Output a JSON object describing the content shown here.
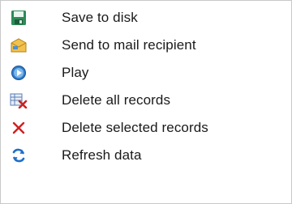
{
  "menu": {
    "items": [
      {
        "label": "Save to disk",
        "icon": "floppy-disk-icon"
      },
      {
        "label": "Send to mail recipient",
        "icon": "mail-envelope-icon"
      },
      {
        "label": "Play",
        "icon": "play-icon"
      },
      {
        "label": "Delete all records",
        "icon": "delete-all-records-icon"
      },
      {
        "label": "Delete selected records",
        "icon": "delete-x-icon"
      },
      {
        "label": "Refresh data",
        "icon": "refresh-icon"
      }
    ]
  },
  "colors": {
    "text": "#1a1a1a",
    "border": "#c8c8c8",
    "save_green": "#2e8b57",
    "delete_red": "#d02020",
    "refresh_blue": "#1e6fc8"
  }
}
